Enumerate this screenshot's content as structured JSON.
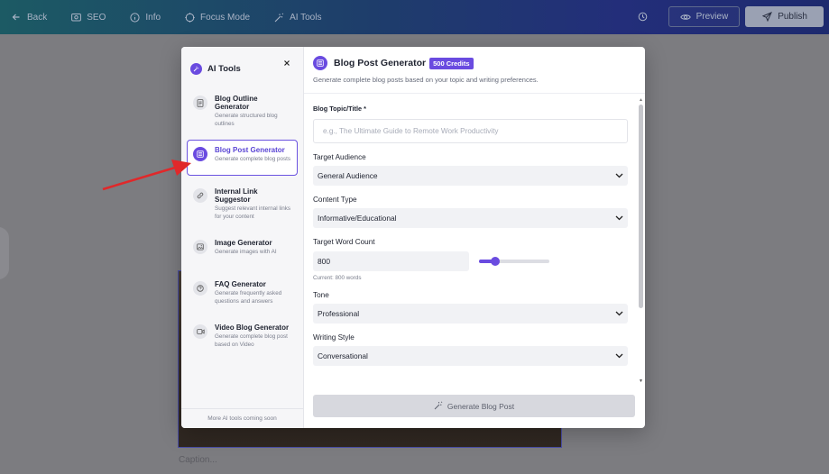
{
  "topbar": {
    "back": "Back",
    "seo": "SEO",
    "info": "Info",
    "focus_mode": "Focus Mode",
    "ai_tools": "AI Tools",
    "preview": "Preview",
    "publish": "Publish"
  },
  "editor": {
    "caption_placeholder": "Caption..."
  },
  "sidebar": {
    "title": "AI Tools",
    "footer": "More AI tools coming soon",
    "items": [
      {
        "name": "Blog Outline Generator",
        "desc": "Generate structured blog outlines",
        "icon": "document-icon"
      },
      {
        "name": "Blog Post Generator",
        "desc": "Generate complete blog posts",
        "icon": "article-icon",
        "active": true
      },
      {
        "name": "Internal Link Suggestor",
        "desc": "Suggest relevant internal links for your content",
        "icon": "link-icon"
      },
      {
        "name": "Image Generator",
        "desc": "Generate images with AI",
        "icon": "image-icon"
      },
      {
        "name": "FAQ Generator",
        "desc": "Generate frequently asked questions and answers",
        "icon": "question-icon"
      },
      {
        "name": "Video Blog Generator",
        "desc": "Generate complete blog post based on Video",
        "icon": "video-icon"
      }
    ]
  },
  "main": {
    "title": "Blog Post Generator",
    "credits": "500 Credits",
    "subtitle": "Generate complete blog posts based on your topic and writing preferences.",
    "topic_label": "Blog Topic/Title *",
    "topic_placeholder": "e.g., The Ultimate Guide to Remote Work Productivity",
    "audience_label": "Target Audience",
    "audience_value": "General Audience",
    "content_type_label": "Content Type",
    "content_type_value": "Informative/Educational",
    "word_count_label": "Target Word Count",
    "word_count_value": "800",
    "word_count_hint": "Current: 800 words",
    "word_count_fraction": 0.23,
    "tone_label": "Tone",
    "tone_value": "Professional",
    "style_label": "Writing Style",
    "style_value": "Conversational",
    "generate_label": "Generate Blog Post"
  },
  "colors": {
    "accent": "#6a4be0",
    "arrow": "#e0282a"
  }
}
